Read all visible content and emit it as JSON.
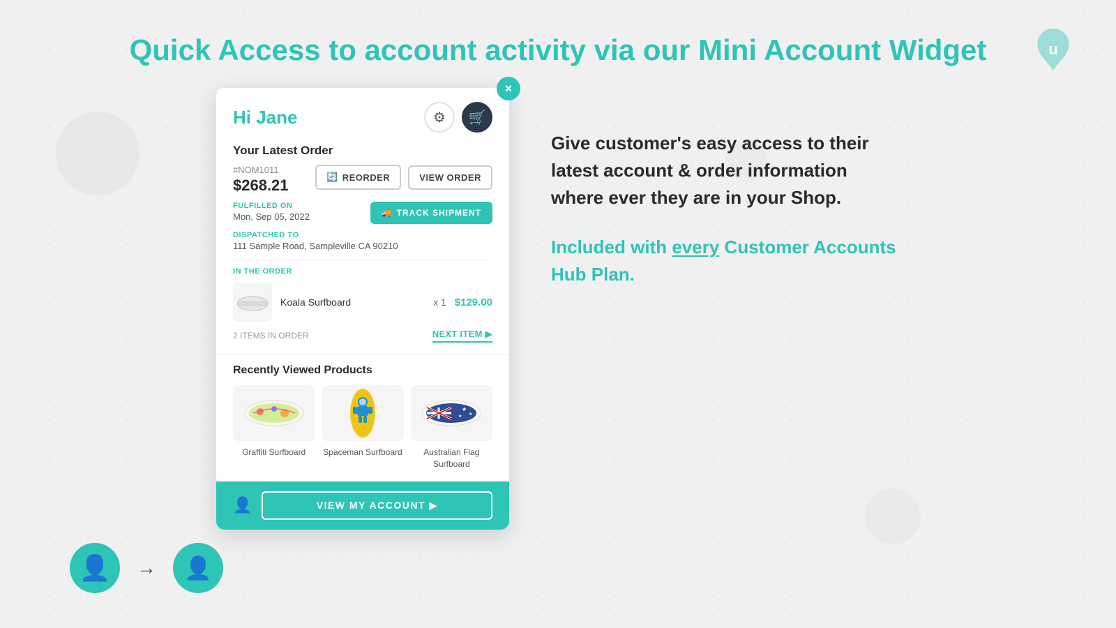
{
  "page": {
    "header_text_plain": "Quick Access to account activity via our ",
    "header_text_accent": "Mini Account Widget",
    "logo_char": "ü"
  },
  "widget": {
    "greeting": "Hi Jane",
    "close_label": "×",
    "settings_icon": "⚙",
    "cart_icon": "🛍",
    "latest_order_title": "Your Latest Order",
    "order_number": "#NOM1011",
    "order_total": "$268.21",
    "reorder_label": "REORDER",
    "view_order_label": "VIEW ORDER",
    "fulfilled_label": "FULFILLED ON",
    "fulfilled_date": "Mon, Sep 05, 2022",
    "track_label": "TRACK SHIPMENT",
    "dispatched_label": "DISPATCHED TO",
    "dispatched_address": "111 Sample Road, Sampleville CA 90210",
    "in_order_label": "IN THE ORDER",
    "item_name": "Koala Surfboard",
    "item_qty": "x 1",
    "item_price": "$129.00",
    "items_count": "2 ITEMS IN ORDER",
    "next_item_label": "NEXT ITEM ▶",
    "recently_viewed_title": "Recently Viewed Products",
    "products": [
      {
        "name": "Graffiti Surfboard",
        "color": "#a0d080"
      },
      {
        "name": "Spaceman Surfboard",
        "color": "#4ab0e0"
      },
      {
        "name": "Australian Flag Surfboard",
        "color": "#2040a0"
      }
    ],
    "footer_view_account": "VIEW MY ACCOUNT ▶"
  },
  "right": {
    "description": "Give customer's easy access to their latest account & order information where ever they are in your Shop.",
    "included_prefix": "Included with ",
    "included_every": "every",
    "included_suffix": " Customer Accounts Hub Plan."
  }
}
